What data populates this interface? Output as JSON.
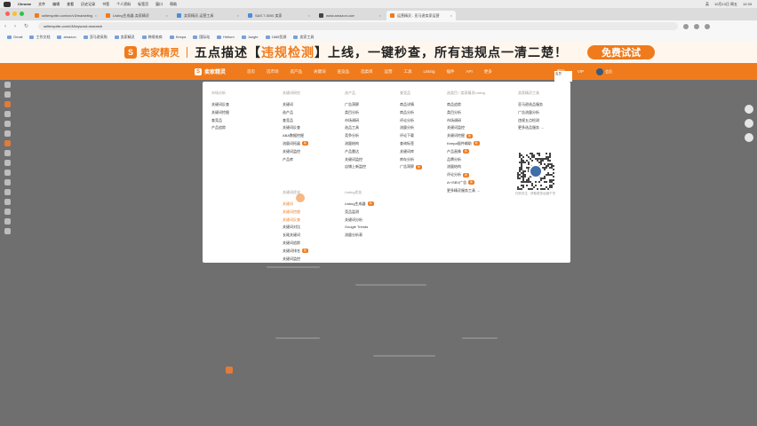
{
  "os_menubar": {
    "app": "Chrome",
    "items": [
      "文件",
      "编辑",
      "查看",
      "历史记录",
      "书签",
      "个人资料",
      "标签页",
      "窗口",
      "帮助"
    ],
    "right": [
      "英",
      "10月13日 周五",
      "12:33"
    ]
  },
  "tabs": [
    {
      "title": "sellersprite.com/cn/v3/marketing",
      "color": "#f07b1d",
      "active": false
    },
    {
      "title": "Listing生成器-卖家精灵",
      "color": "#f07b1d",
      "active": false
    },
    {
      "title": "卖家精灵-运营工具",
      "color": "#4a90d9",
      "active": false
    },
    {
      "title": "SAS 7.3000 卖家",
      "color": "#4a90d9",
      "active": false
    },
    {
      "title": "www.amazon.com",
      "color": "#444",
      "active": false
    },
    {
      "title": "运营精灵 - 亚马逊卖家运营",
      "color": "#f07b1d",
      "active": true
    }
  ],
  "address": {
    "url": "sellersprite.com/v3/keyword-research"
  },
  "bookmarks": [
    "Gmail",
    "工作文档",
    "amazon",
    "亚马逊采购",
    "卖家精灵",
    "跨境电商",
    "Keepa",
    "国际站",
    "Helium",
    "Jungle",
    "1688货源",
    "卖家工具"
  ],
  "banner": {
    "brand": "卖家精灵",
    "slogan_a": "五点描述【",
    "slogan_hl": "违规检测",
    "slogan_b": "】上线，一键秒查，所有违规点一清二楚！",
    "button": "免费试试"
  },
  "site_nav": {
    "brand": "卖家精灵",
    "items": [
      "首页",
      "选市场",
      "选产品",
      "关键词",
      "查竞品",
      "选类目",
      "运营",
      "工具",
      "Listing",
      "插件",
      "API",
      "更多"
    ],
    "right": [
      "帮助",
      "VIP"
    ],
    "user": "会员"
  },
  "menu": {
    "columns": [
      {
        "title": "市场分析",
        "items": [
          {
            "t": "关键词反查"
          },
          {
            "t": "关键词挖掘"
          },
          {
            "t": "查竞品"
          },
          {
            "t": "产品追踪"
          }
        ]
      },
      {
        "title": "关键词研究",
        "items": [
          {
            "t": "关键词"
          },
          {
            "t": "选产品"
          },
          {
            "t": "查竞品"
          },
          {
            "t": "关键词反查"
          },
          {
            "t": "ABA数据挖掘"
          },
          {
            "t": "流量词拓展",
            "badge": "新"
          },
          {
            "t": "关键词监控"
          },
          {
            "t": "产品库"
          }
        ]
      },
      {
        "title": "选产品",
        "items": [
          {
            "t": "广告洞察"
          },
          {
            "t": "类目分析"
          },
          {
            "t": "市场调研"
          },
          {
            "t": "选品工具"
          },
          {
            "t": "竞争分析"
          },
          {
            "t": "流量结构"
          },
          {
            "t": "产品雷达"
          },
          {
            "t": "关键词监控"
          },
          {
            "t": "店铺上新监控"
          }
        ]
      },
      {
        "title": "查竞品",
        "items": [
          {
            "t": "商品详情"
          },
          {
            "t": "商品分析"
          },
          {
            "t": "评论分析"
          },
          {
            "t": "流量分析"
          },
          {
            "t": "评论下载"
          },
          {
            "t": "查询标签"
          },
          {
            "t": "关键词库"
          },
          {
            "t": "库存分析"
          },
          {
            "t": "广告洞察",
            "badge": "新"
          }
        ]
      },
      {
        "title": "选类目 / 卖家精灵Listing",
        "items": [
          {
            "t": "商品追踪"
          },
          {
            "t": "类目分析"
          },
          {
            "t": "市场调研"
          },
          {
            "t": "关键词监控"
          },
          {
            "t": "关键词挖掘",
            "badge": "新"
          },
          {
            "t": "Keepa插件辅助",
            "badge": "新"
          },
          {
            "t": "产品画像",
            "badge": "新"
          },
          {
            "t": "品牌分析"
          },
          {
            "t": "流量结构"
          },
          {
            "t": "评论分析",
            "badge": "新"
          },
          {
            "t": "A+/SBV广告",
            "badge": "新"
          },
          {
            "t": "更多精灵服务工具 →"
          }
        ]
      },
      {
        "title": "卖家精灵工具",
        "items": [
          {
            "t": "亚马逊选品服务"
          },
          {
            "t": "广告流量分析"
          },
          {
            "t": "违规五点检测"
          },
          {
            "t": "更多选品服务 →"
          }
        ]
      }
    ],
    "lower_columns": [
      {
        "title": "关键词优化",
        "items": [
          {
            "t": "关键词",
            "on": true
          },
          {
            "t": "关键词挖掘",
            "on": true
          },
          {
            "t": "关键词反查",
            "on": true
          },
          {
            "t": "关键词对比"
          },
          {
            "t": "长尾关键词"
          },
          {
            "t": "关键词追踪"
          },
          {
            "t": "关键词排名",
            "badge": "新"
          },
          {
            "t": "关键词监控"
          }
        ]
      },
      {
        "title": "Listing优化",
        "items": [
          {
            "t": "Listing生成器",
            "badge": "新"
          },
          {
            "t": "竞品监测"
          },
          {
            "t": "关键词分析"
          },
          {
            "t": "Google Trends"
          },
          {
            "t": "流量分析表"
          }
        ]
      }
    ],
    "qr_caption": "扫码关注 · 获取更多运营干货"
  }
}
